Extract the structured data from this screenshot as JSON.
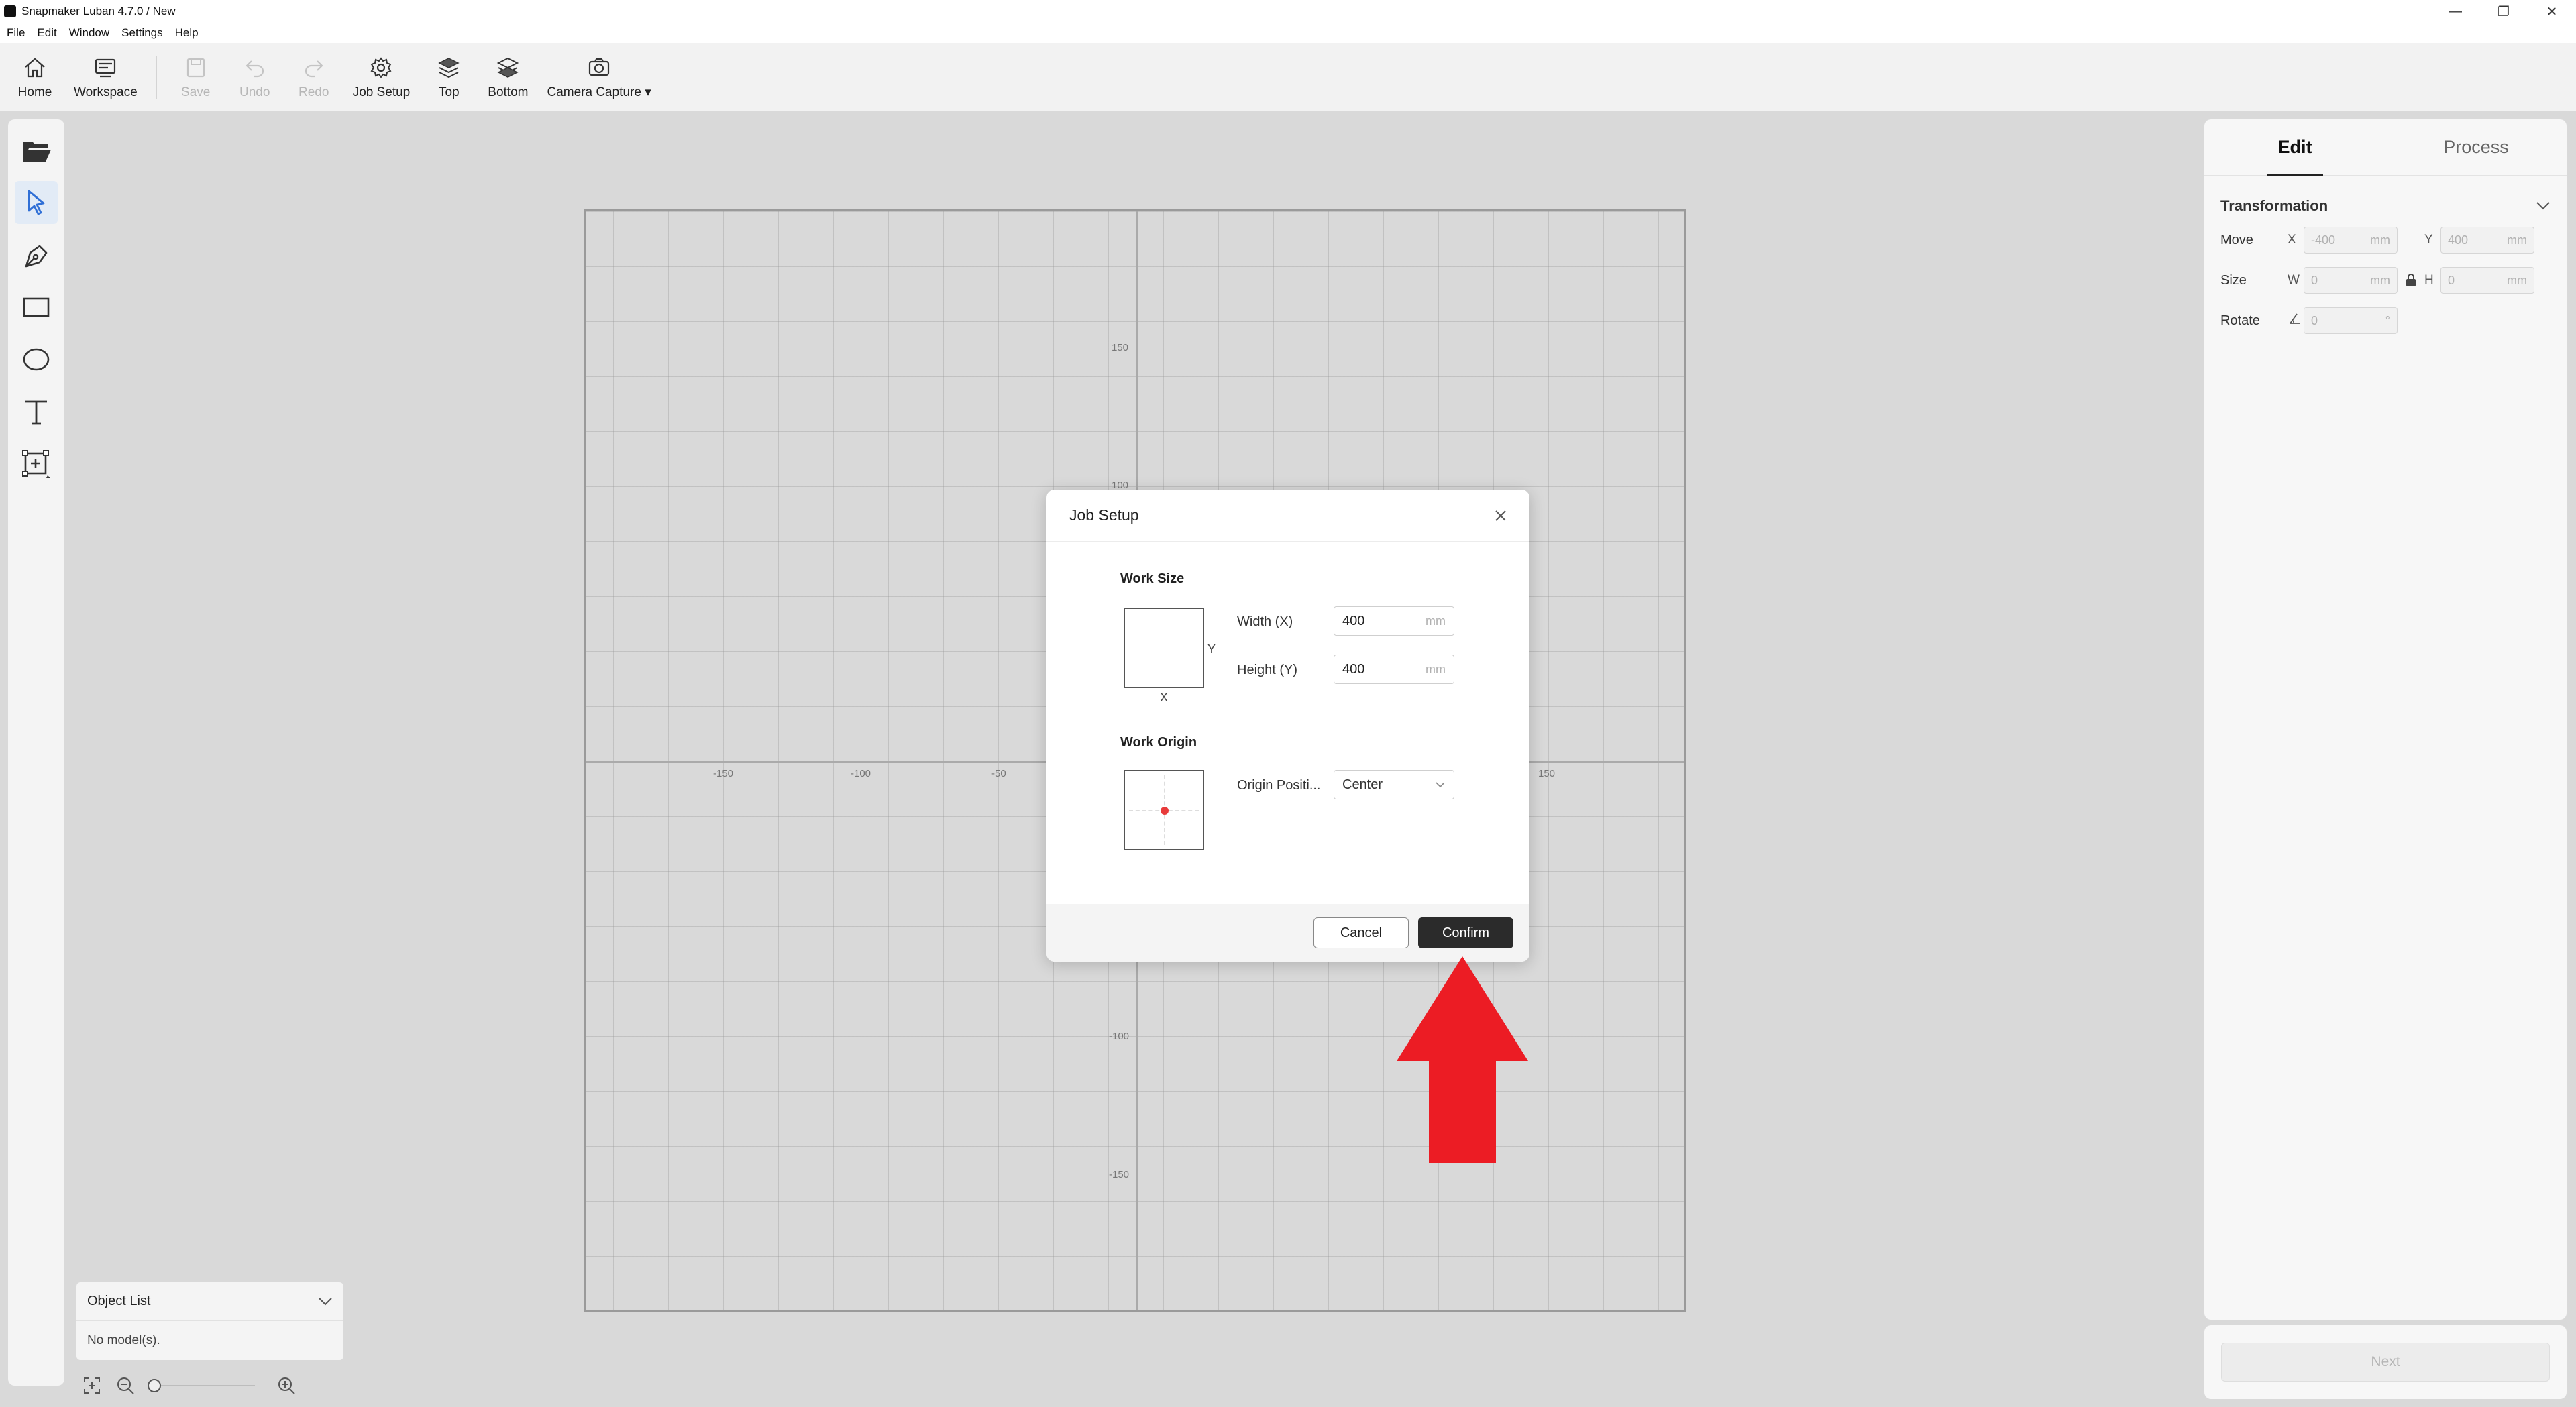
{
  "window": {
    "title": "Snapmaker Luban 4.7.0 / New",
    "minimize": "—",
    "restore": "❐",
    "close": "✕"
  },
  "menu": [
    "File",
    "Edit",
    "Window",
    "Settings",
    "Help"
  ],
  "toolbar": {
    "home": "Home",
    "workspace": "Workspace",
    "save": "Save",
    "undo": "Undo",
    "redo": "Redo",
    "job_setup": "Job Setup",
    "top": "Top",
    "bottom": "Bottom",
    "camera_capture": "Camera Capture"
  },
  "canvas": {
    "ticks_x": [
      "-150",
      "-100",
      "-50",
      "150"
    ],
    "ticks_y": [
      "150",
      "100",
      "-100",
      "-150"
    ]
  },
  "object_list": {
    "title": "Object List",
    "empty": "No model(s)."
  },
  "right_panel": {
    "tabs": [
      "Edit",
      "Process"
    ],
    "transformation": "Transformation",
    "move": {
      "label": "Move",
      "x_label": "X",
      "x_value": "-400",
      "y_label": "Y",
      "y_value": "400",
      "unit": "mm"
    },
    "size": {
      "label": "Size",
      "w_label": "W",
      "w_value": "0",
      "h_label": "H",
      "h_value": "0",
      "unit": "mm"
    },
    "rotate": {
      "label": "Rotate",
      "value": "0",
      "unit": "°"
    },
    "next": "Next"
  },
  "modal": {
    "title": "Job Setup",
    "work_size": "Work Size",
    "axis_x": "X",
    "axis_y": "Y",
    "width_label": "Width (X)",
    "width_value": "400",
    "height_label": "Height (Y)",
    "height_value": "400",
    "unit": "mm",
    "work_origin": "Work Origin",
    "origin_label": "Origin Positi...",
    "origin_value": "Center",
    "cancel": "Cancel",
    "confirm": "Confirm"
  },
  "colors": {
    "annotation_arrow": "#ec1c24",
    "confirm_bg": "#2b2b2b",
    "origin_dot": "#e83b3b"
  }
}
